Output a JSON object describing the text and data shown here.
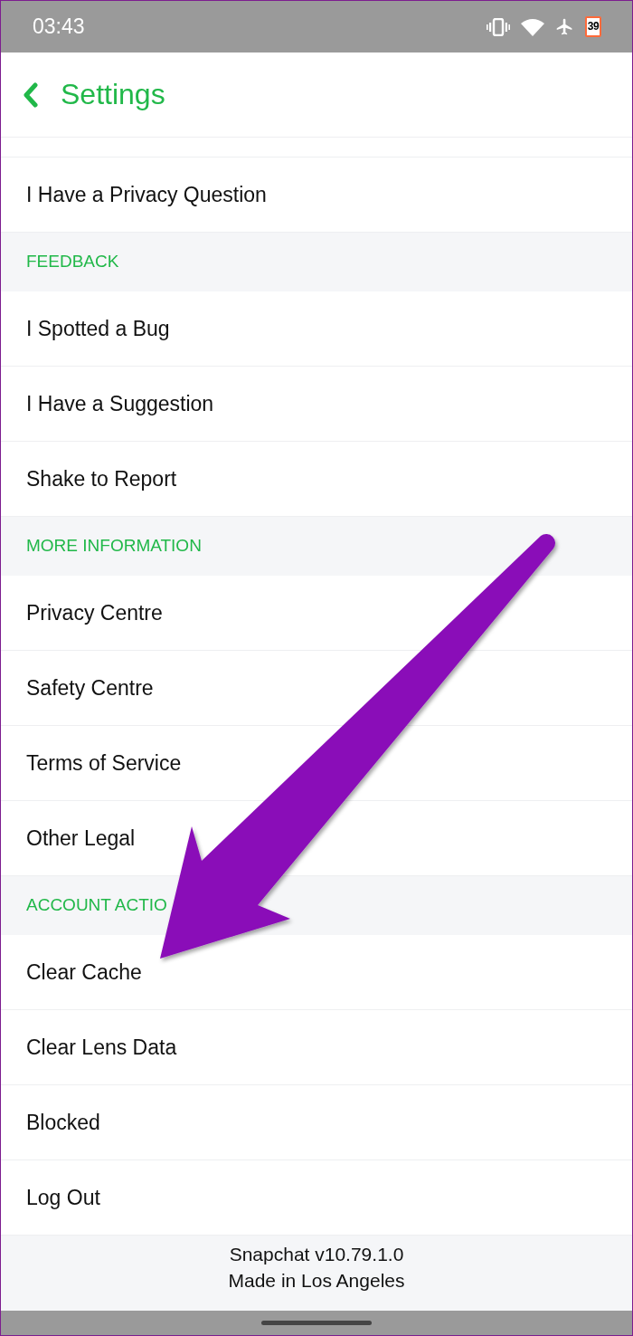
{
  "status_bar": {
    "time": "03:43",
    "battery": "39"
  },
  "header": {
    "title": "Settings"
  },
  "sections": [
    {
      "rows": [
        {
          "label": "I Have a Privacy Question"
        }
      ]
    },
    {
      "heading": "FEEDBACK",
      "rows": [
        {
          "label": "I Spotted a Bug"
        },
        {
          "label": "I Have a Suggestion"
        },
        {
          "label": "Shake to Report"
        }
      ]
    },
    {
      "heading": "MORE INFORMATION",
      "rows": [
        {
          "label": "Privacy Centre"
        },
        {
          "label": "Safety Centre"
        },
        {
          "label": "Terms of Service"
        },
        {
          "label": "Other Legal"
        }
      ]
    },
    {
      "heading": "ACCOUNT ACTIO",
      "rows": [
        {
          "label": "Clear Cache"
        },
        {
          "label": "Clear Lens Data"
        },
        {
          "label": "Blocked"
        },
        {
          "label": "Log Out"
        }
      ]
    }
  ],
  "footer": [
    "Snapchat v10.79.1.0",
    "Made in Los Angeles"
  ],
  "annotations": [
    {
      "kind": "arrow"
    }
  ]
}
